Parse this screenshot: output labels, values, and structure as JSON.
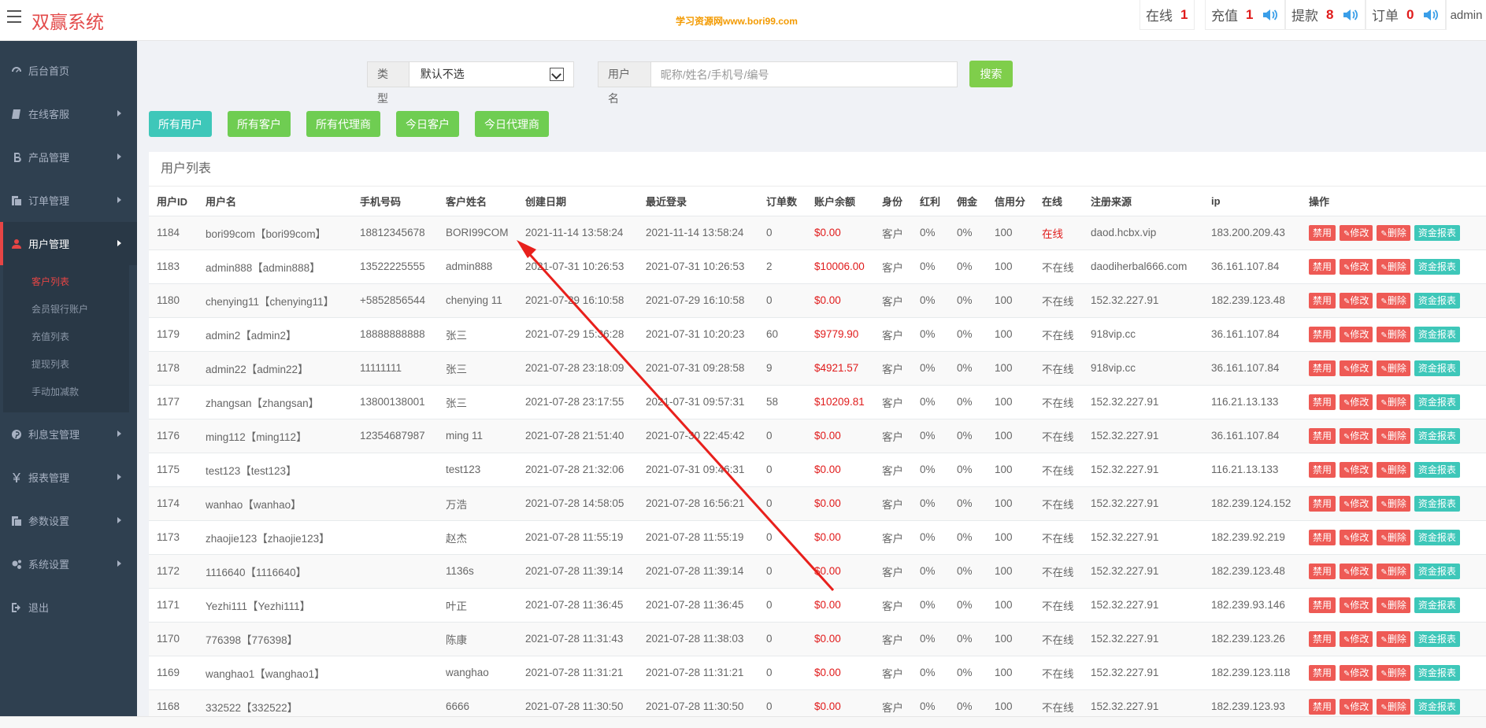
{
  "app": {
    "title": "双赢系统",
    "watermark": "学习资源网www.bori99.com",
    "user": "admin"
  },
  "stats": [
    {
      "label": "在线",
      "value": "1",
      "sound": false
    },
    {
      "label": "充值",
      "value": "1",
      "sound": true
    },
    {
      "label": "提款",
      "value": "8",
      "sound": true
    },
    {
      "label": "订单",
      "value": "0",
      "sound": true
    }
  ],
  "sidebar": {
    "items": [
      {
        "label": "后台首页",
        "icon": "dashboard-icon"
      },
      {
        "label": "在线客服",
        "icon": "book-icon"
      },
      {
        "label": "产品管理",
        "icon": "bitcoin-icon"
      },
      {
        "label": "订单管理",
        "icon": "copy-icon"
      },
      {
        "label": "用户管理",
        "icon": "user-icon"
      },
      {
        "label": "利息宝管理",
        "icon": "pinterest-icon"
      },
      {
        "label": "报表管理",
        "icon": "yen-icon"
      },
      {
        "label": "参数设置",
        "icon": "copy-icon"
      },
      {
        "label": "系统设置",
        "icon": "cogs-icon"
      },
      {
        "label": "退出",
        "icon": "sign-out-icon"
      }
    ],
    "subitems": [
      "客户列表",
      "会员银行账户",
      "充值列表",
      "提现列表",
      "手动加减款"
    ]
  },
  "search": {
    "type_label": "类型",
    "type_value": "默认不选",
    "user_label": "用户名",
    "user_placeholder": "昵称/姓名/手机号/编号",
    "button": "搜索"
  },
  "filters": [
    "所有用户",
    "所有客户",
    "所有代理商",
    "今日客户",
    "今日代理商"
  ],
  "table": {
    "title": "用户列表",
    "headers": [
      "用户ID",
      "用户名",
      "手机号码",
      "客户姓名",
      "创建日期",
      "最近登录",
      "订单数",
      "账户余额",
      "身份",
      "红利",
      "佣金",
      "信用分",
      "在线",
      "注册来源",
      "ip",
      "操作"
    ],
    "actions": [
      "禁用",
      "修改",
      "删除",
      "资金报表"
    ],
    "rows": [
      [
        "1184",
        "bori99com【bori99com】",
        "18812345678",
        "BORI99COM",
        "2021-11-14 13:58:24",
        "2021-11-14 13:58:24",
        "0",
        "$0.00",
        "客户",
        "0%",
        "0%",
        "100",
        "在线",
        "daod.hcbx.vip",
        "183.200.209.43"
      ],
      [
        "1183",
        "admin888【admin888】",
        "13522225555",
        "admin888",
        "2021-07-31 10:26:53",
        "2021-07-31 10:26:53",
        "2",
        "$10006.00",
        "客户",
        "0%",
        "0%",
        "100",
        "不在线",
        "daodiherbal666.com",
        "36.161.107.84"
      ],
      [
        "1180",
        "chenying11【chenying11】",
        "+5852856544",
        "chenying 11",
        "2021-07-29 16:10:58",
        "2021-07-29 16:10:58",
        "0",
        "$0.00",
        "客户",
        "0%",
        "0%",
        "100",
        "不在线",
        "152.32.227.91",
        "182.239.123.48"
      ],
      [
        "1179",
        "admin2【admin2】",
        "18888888888",
        "张三",
        "2021-07-29 15:36:28",
        "2021-07-31 10:20:23",
        "60",
        "$9779.90",
        "客户",
        "0%",
        "0%",
        "100",
        "不在线",
        "918vip.cc",
        "36.161.107.84"
      ],
      [
        "1178",
        "admin22【admin22】",
        "11111111",
        "张三",
        "2021-07-28 23:18:09",
        "2021-07-31 09:28:58",
        "9",
        "$4921.57",
        "客户",
        "0%",
        "0%",
        "100",
        "不在线",
        "918vip.cc",
        "36.161.107.84"
      ],
      [
        "1177",
        "zhangsan【zhangsan】",
        "13800138001",
        "张三",
        "2021-07-28 23:17:55",
        "2021-07-31 09:57:31",
        "58",
        "$10209.81",
        "客户",
        "0%",
        "0%",
        "100",
        "不在线",
        "152.32.227.91",
        "116.21.13.133"
      ],
      [
        "1176",
        "ming112【ming112】",
        "12354687987",
        "ming 11",
        "2021-07-28 21:51:40",
        "2021-07-30 22:45:42",
        "0",
        "$0.00",
        "客户",
        "0%",
        "0%",
        "100",
        "不在线",
        "152.32.227.91",
        "36.161.107.84"
      ],
      [
        "1175",
        "test123【test123】",
        "",
        "test123",
        "2021-07-28 21:32:06",
        "2021-07-31 09:46:31",
        "0",
        "$0.00",
        "客户",
        "0%",
        "0%",
        "100",
        "不在线",
        "152.32.227.91",
        "116.21.13.133"
      ],
      [
        "1174",
        "wanhao【wanhao】",
        "",
        "万浩",
        "2021-07-28 14:58:05",
        "2021-07-28 16:56:21",
        "0",
        "$0.00",
        "客户",
        "0%",
        "0%",
        "100",
        "不在线",
        "152.32.227.91",
        "182.239.124.152"
      ],
      [
        "1173",
        "zhaojie123【zhaojie123】",
        "",
        "赵杰",
        "2021-07-28 11:55:19",
        "2021-07-28 11:55:19",
        "0",
        "$0.00",
        "客户",
        "0%",
        "0%",
        "100",
        "不在线",
        "152.32.227.91",
        "182.239.92.219"
      ],
      [
        "1172",
        "1116640【1116640】",
        "",
        "1136s",
        "2021-07-28 11:39:14",
        "2021-07-28 11:39:14",
        "0",
        "$0.00",
        "客户",
        "0%",
        "0%",
        "100",
        "不在线",
        "152.32.227.91",
        "182.239.123.48"
      ],
      [
        "1171",
        "Yezhi111【Yezhi111】",
        "",
        "叶正",
        "2021-07-28 11:36:45",
        "2021-07-28 11:36:45",
        "0",
        "$0.00",
        "客户",
        "0%",
        "0%",
        "100",
        "不在线",
        "152.32.227.91",
        "182.239.93.146"
      ],
      [
        "1170",
        "776398【776398】",
        "",
        "陈康",
        "2021-07-28 11:31:43",
        "2021-07-28 11:38:03",
        "0",
        "$0.00",
        "客户",
        "0%",
        "0%",
        "100",
        "不在线",
        "152.32.227.91",
        "182.239.123.26"
      ],
      [
        "1169",
        "wanghao1【wanghao1】",
        "",
        "wanghao",
        "2021-07-28 11:31:21",
        "2021-07-28 11:31:21",
        "0",
        "$0.00",
        "客户",
        "0%",
        "0%",
        "100",
        "不在线",
        "152.32.227.91",
        "182.239.123.118"
      ],
      [
        "1168",
        "332522【332522】",
        "",
        "6666",
        "2021-07-28 11:30:50",
        "2021-07-28 11:30:50",
        "0",
        "$0.00",
        "客户",
        "0%",
        "0%",
        "100",
        "不在线",
        "152.32.227.91",
        "182.239.123.93"
      ]
    ]
  },
  "colors": {
    "sidebar_bg": "#2f4050",
    "accent_red": "#e64545",
    "btn_green": "#6fcd52",
    "btn_teal": "#3ec7b9"
  }
}
